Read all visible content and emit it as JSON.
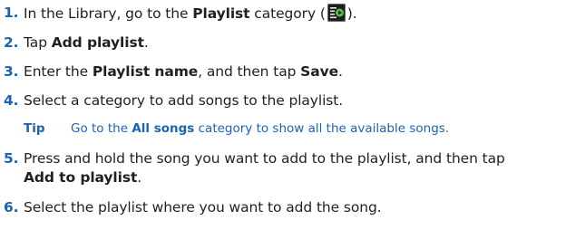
{
  "steps": [
    {
      "num": "1.",
      "pre": "In the Library, go to the ",
      "bold": "Playlist",
      "post": " category (",
      "icon": "playlist-category-icon",
      "end": ")."
    },
    {
      "num": "2.",
      "pre": "Tap ",
      "bold": "Add playlist",
      "post": "."
    },
    {
      "num": "3.",
      "pre": "Enter the ",
      "bold": "Playlist name",
      "mid": ", and then tap ",
      "bold2": "Save",
      "post": "."
    },
    {
      "num": "4.",
      "text": "Select a category to add songs to the playlist."
    },
    {
      "num": "5.",
      "text": "Press and hold the song you want to add to the playlist, and then tap",
      "cont_bold": "Add to playlist",
      "cont_post": "."
    },
    {
      "num": "6.",
      "text": "Select the playlist where you want to add the song."
    }
  ],
  "tip": {
    "label": "Tip",
    "pre": "Go to the ",
    "bold": "All songs",
    "post": " category to show all the available songs."
  },
  "colors": {
    "accent": "#1a64b4",
    "text": "#231f20",
    "icon_bg": "#1c1c1c",
    "icon_fg": "#4cc44c"
  }
}
